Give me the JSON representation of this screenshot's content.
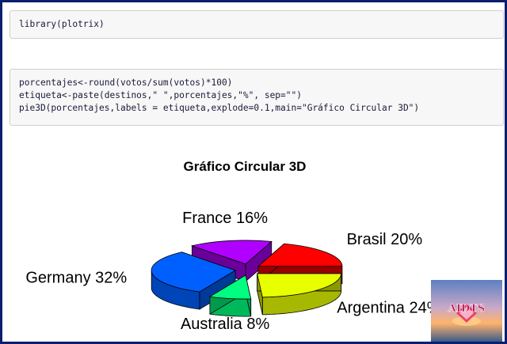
{
  "code_cells": [
    {
      "lines": [
        "library(plotrix)"
      ]
    },
    {
      "lines": [
        "porcentajes<-round(votos/sum(votos)*100)",
        "etiqueta<-paste(destinos,\" \",porcentajes,\"%\", sep=\"\")",
        "pie3D(porcentajes,labels = etiqueta,explode=0.1,main=\"Gráfico Circular 3D\")"
      ]
    }
  ],
  "chart_data": {
    "type": "pie",
    "title": "Gráfico Circular 3D",
    "three_d": true,
    "explode": 0.1,
    "slices": [
      {
        "label": "Brasil 20%",
        "value": 20,
        "color": "#ff0000"
      },
      {
        "label": "France 16%",
        "value": 16,
        "color": "#b000ff"
      },
      {
        "label": "Germany 32%",
        "value": 32,
        "color": "#0060ff"
      },
      {
        "label": "Australia 8%",
        "value": 8,
        "color": "#00ff80"
      },
      {
        "label": "Argentina 24%",
        "value": 24,
        "color": "#e8ff00"
      }
    ]
  },
  "logo": {
    "text": "AIDTS",
    "colors": {
      "sky": "#9fb4d8",
      "sun": "#ff9a3c",
      "text": "#d81a5a"
    }
  }
}
